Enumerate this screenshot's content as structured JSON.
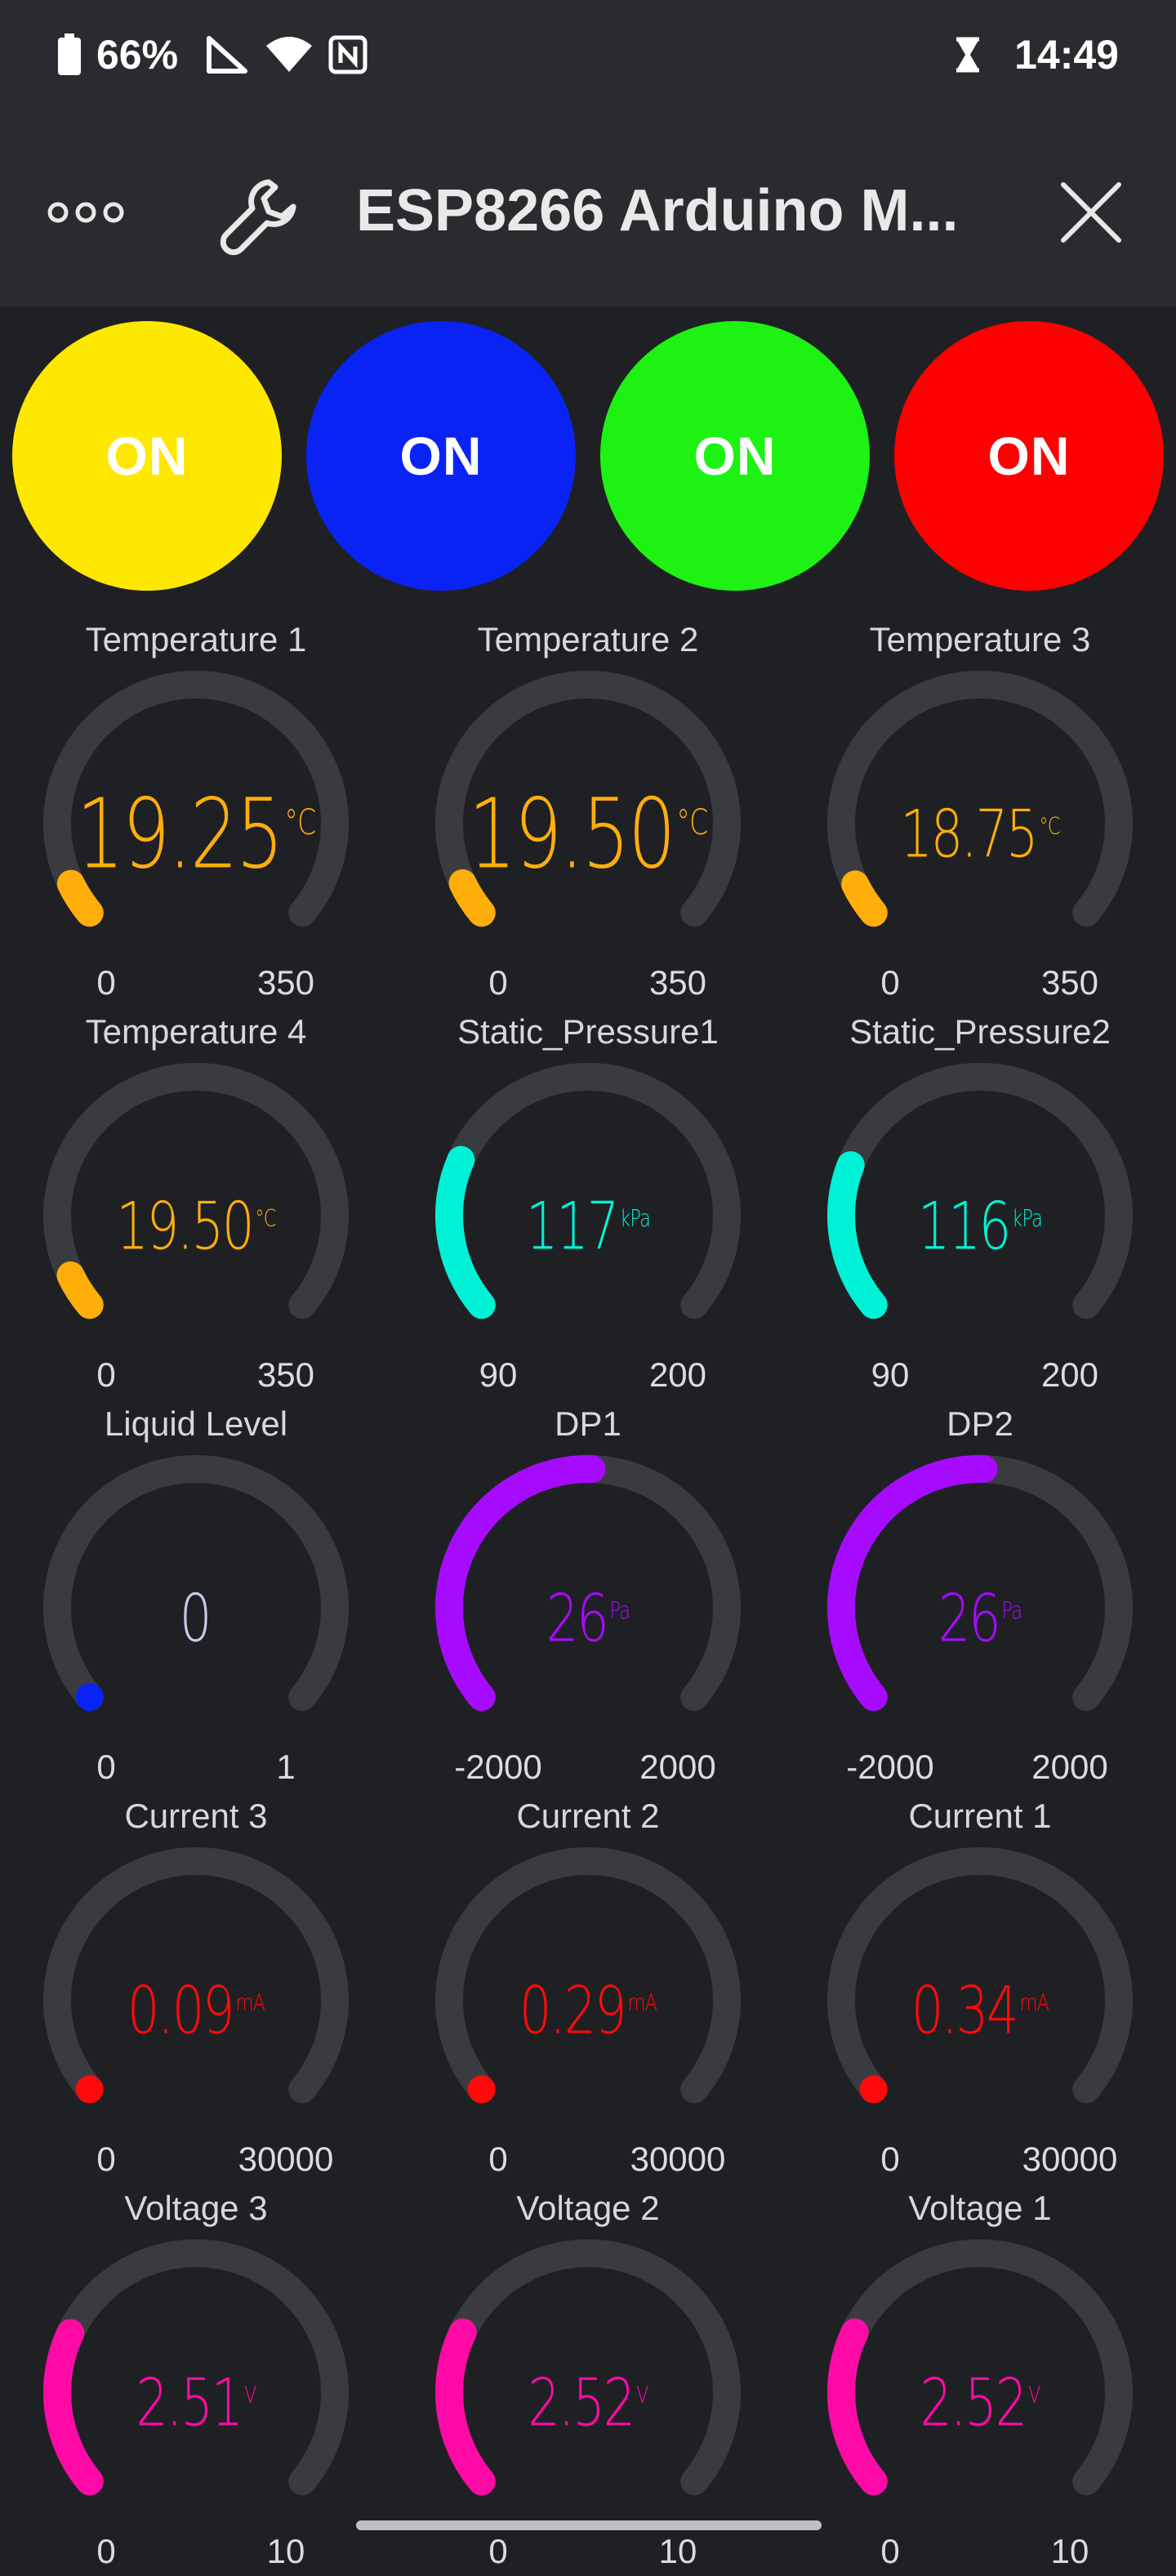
{
  "status_bar": {
    "battery": "66%",
    "time": "14:49",
    "icons": [
      "battery-icon",
      "signal-icon",
      "wifi-icon",
      "nfc-icon",
      "hourglass-icon"
    ]
  },
  "app_bar": {
    "title": "ESP8266 Arduino M...",
    "icons": [
      "more-icon",
      "wrench-icon",
      "close-icon"
    ]
  },
  "buttons": [
    {
      "label": "ON",
      "color": "#ffe800"
    },
    {
      "label": "ON",
      "color": "#0a23f5"
    },
    {
      "label": "ON",
      "color": "#1ef213"
    },
    {
      "label": "ON",
      "color": "#ff0000"
    }
  ],
  "gauges": [
    {
      "title": "Temperature 1",
      "value": "19.25",
      "unit": "°C",
      "min": "0",
      "max": "350",
      "fraction": 0.055,
      "color": "#ffae0a",
      "size": "big"
    },
    {
      "title": "Temperature 2",
      "value": "19.50",
      "unit": "°C",
      "min": "0",
      "max": "350",
      "fraction": 0.056,
      "color": "#ffae0a",
      "size": "big"
    },
    {
      "title": "Temperature 3",
      "value": "18.75",
      "unit": "°C",
      "min": "0",
      "max": "350",
      "fraction": 0.054,
      "color": "#ffae0a",
      "size": "small"
    },
    {
      "title": "Temperature 4",
      "value": "19.50",
      "unit": "°C",
      "min": "0",
      "max": "350",
      "fraction": 0.056,
      "color": "#ffae0a",
      "size": "small"
    },
    {
      "title": "Static_Pressure1",
      "value": "117",
      "unit": "kPa",
      "min": "90",
      "max": "200",
      "fraction": 0.245,
      "color": "#00f2d6",
      "size": "small"
    },
    {
      "title": "Static_Pressure2",
      "value": "116",
      "unit": "kPa",
      "min": "90",
      "max": "200",
      "fraction": 0.236,
      "color": "#00f2d6",
      "size": "small"
    },
    {
      "title": "Liquid Level",
      "value": "0",
      "unit": "",
      "min": "0",
      "max": "1",
      "fraction": 0.0,
      "color": "#0a23f5",
      "size": "small"
    },
    {
      "title": "DP1",
      "value": "26",
      "unit": "Pa",
      "min": "-2000",
      "max": "2000",
      "fraction": 0.506,
      "color": "#a60bff",
      "size": "small"
    },
    {
      "title": "DP2",
      "value": "26",
      "unit": "Pa",
      "min": "-2000",
      "max": "2000",
      "fraction": 0.506,
      "color": "#a60bff",
      "size": "small"
    },
    {
      "title": "Current 3",
      "value": "0.09",
      "unit": "mA",
      "min": "0",
      "max": "30000",
      "fraction": 0.0,
      "color": "#ff0a0a",
      "size": "small"
    },
    {
      "title": "Current 2",
      "value": "0.29",
      "unit": "mA",
      "min": "0",
      "max": "30000",
      "fraction": 0.0,
      "color": "#ff0a0a",
      "size": "small"
    },
    {
      "title": "Current 1",
      "value": "0.34",
      "unit": "mA",
      "min": "0",
      "max": "30000",
      "fraction": 0.0,
      "color": "#ff0a0a",
      "size": "small"
    },
    {
      "title": "Voltage 3",
      "value": "2.51",
      "unit": "V",
      "min": "0",
      "max": "10",
      "fraction": 0.251,
      "color": "#ff0aa6",
      "size": "small"
    },
    {
      "title": "Voltage 2",
      "value": "2.52",
      "unit": "V",
      "min": "0",
      "max": "10",
      "fraction": 0.252,
      "color": "#ff0aa6",
      "size": "small"
    },
    {
      "title": "Voltage 1",
      "value": "2.52",
      "unit": "V",
      "min": "0",
      "max": "10",
      "fraction": 0.252,
      "color": "#ff0aa6",
      "size": "small"
    }
  ]
}
